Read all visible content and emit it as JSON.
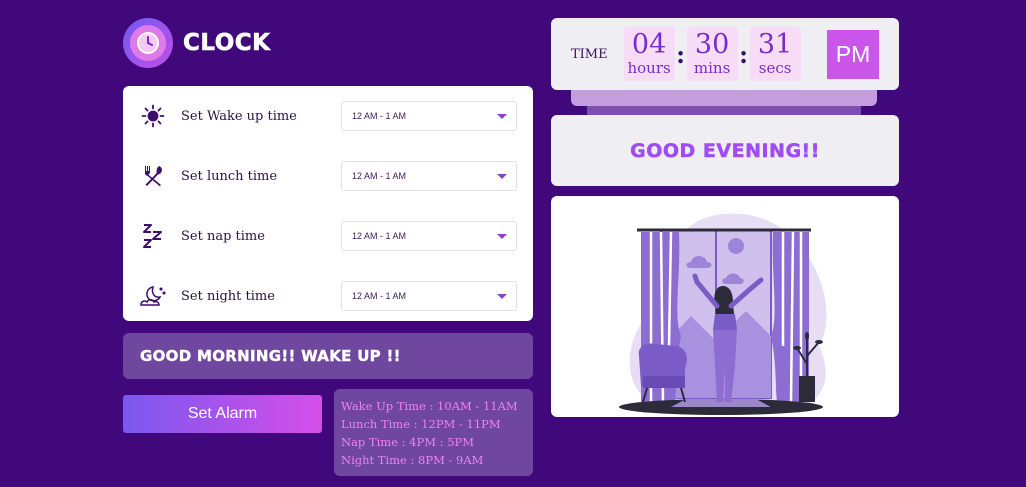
{
  "app": {
    "title": "CLOCK",
    "logo_icon": "clock-icon"
  },
  "settings": [
    {
      "icon": "sun-icon",
      "label": "Set Wake up time",
      "value": "12 AM - 1 AM"
    },
    {
      "icon": "fork-spoon-icon",
      "label": "Set lunch time",
      "value": "12 AM - 1 AM"
    },
    {
      "icon": "zzz-icon",
      "label": "Set nap time",
      "value": "12 AM - 1 AM"
    },
    {
      "icon": "moon-icon",
      "label": "Set night time",
      "value": "12 AM - 1 AM"
    }
  ],
  "greeting_message": "GOOD MORNING!! WAKE UP !!",
  "alarm_button": "Set Alarm",
  "schedule": [
    "Wake Up Time : 10AM - 11AM",
    "Lunch Time : 12PM - 11PM",
    "Nap Time : 4PM : 5PM",
    "Night Time : 8PM - 9AM"
  ],
  "clock": {
    "label": "TIME",
    "hours": "04",
    "hours_unit": "hours",
    "mins": "30",
    "mins_unit": "mins",
    "secs": "31",
    "secs_unit": "secs",
    "separator": ":",
    "period": "PM"
  },
  "day_greeting": "GOOD EVENING!!",
  "colors": {
    "background": "#41087b",
    "accent": "#cb55ea",
    "greeting_purple": "#a04cf5"
  }
}
